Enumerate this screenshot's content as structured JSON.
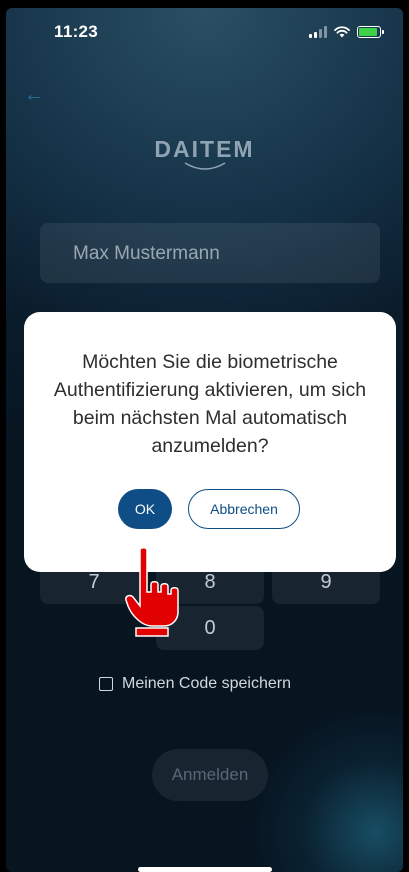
{
  "status_bar": {
    "time": "11:23",
    "battery_level": 0.8
  },
  "app": {
    "logo_text": "DAITEM",
    "back_icon": "arrow-left-icon"
  },
  "login": {
    "name_value": "Max Mustermann",
    "keypad_keys": [
      "7",
      "8",
      "9",
      "0"
    ],
    "save_code_label": "Meinen Code speichern",
    "login_button": "Anmelden"
  },
  "dialog": {
    "message": "Möchten Sie die biometrische Authentifizierung aktivieren, um sich beim nächsten Mal automatisch anzumelden?",
    "ok_label": "OK",
    "cancel_label": "Abbrechen"
  },
  "colors": {
    "primary": "#0e4d85",
    "background": "#0a1b2a",
    "battery": "#3fd14a",
    "pointer_hand": "#e00000"
  }
}
